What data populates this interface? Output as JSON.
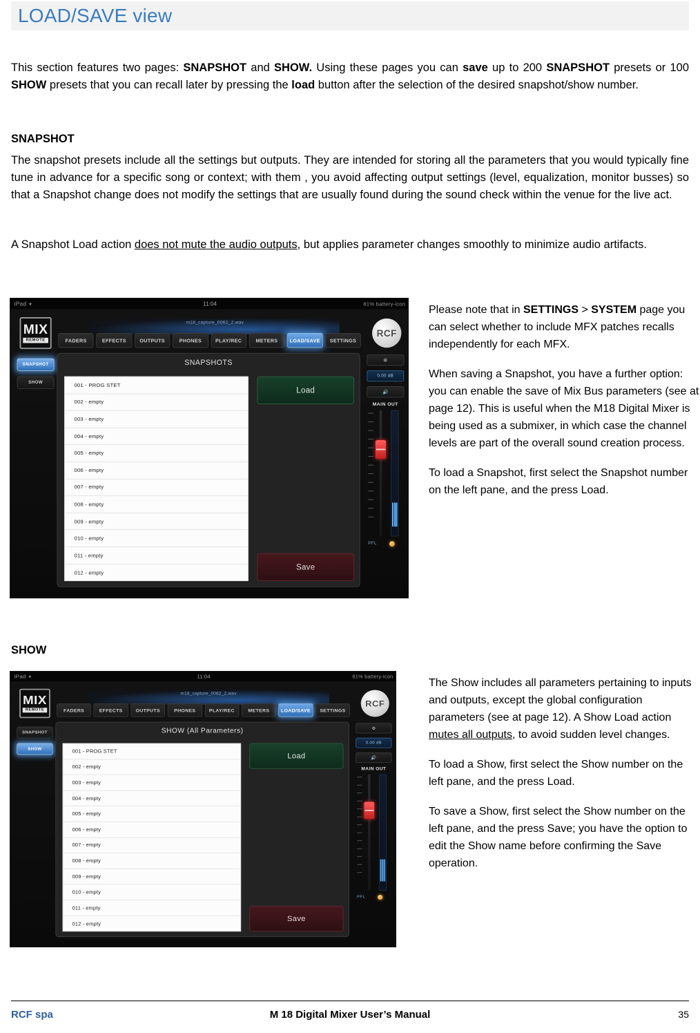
{
  "header": {
    "title": "LOAD/SAVE view"
  },
  "intro": {
    "line": "This section features two pages: SNAPSHOT and SHOW. Using these pages you can save up to 200 SNAPSHOT presets or 100 SHOW presets that you can recall later by pressing the load button after the selection of the desired snapshot/show number.",
    "t1": "This  section  features  two  pages:  ",
    "b1": "SNAPSHOT",
    "t2": "  and  ",
    "b2": "SHOW.",
    "t3": "  Using  these  pages  you  can  ",
    "b3": "save",
    "t4": "  up  to  200  ",
    "b4": "SNAPSHOT",
    "t5": "  presets  or  100  ",
    "b5": "SHOW",
    "t6": "  presets  that  you  can  recall  later  by  pressing  the  ",
    "b6": "load",
    "t7": "  button  after  the selection of the desired snapshot/show number."
  },
  "snapshot_section": {
    "heading": "SNAPSHOT",
    "para1": "The snapshot presets include all the settings but outputs. They are intended for storing all the parameters that you would typically fine tune in advance for a specific song or context; with them , you avoid affecting output settings (level, equalization, monitor busses) so that a Snapshot change does not modify the settings that are usually found during the sound check within the venue for the live act.",
    "para2_a": "A  Snapshot   Load  action  ",
    "para2_u": "does  not  mute  the  audio  outputs",
    "para2_b": ",  but  applies  parameter  changes  smoothly  to minimize audio artifacts."
  },
  "show_section": {
    "heading": "SHOW"
  },
  "note_snapshot": {
    "p1_a": "Please note that in ",
    "p1_b1": "SETTINGS",
    "p1_mid": " > ",
    "p1_b2": "SYSTEM",
    "p1_c": " page you can select whether to include MFX patches recalls independently for each MFX.",
    "p2": "When saving a Snapshot, you have a further option: you can enable the save of Mix Bus parameters (see at page 12). This is useful when the M18 Digital Mixer is being used as a submixer, in which case the channel levels are part of the overall sound creation process.",
    "p3": "To load a Snapshot, first select the Snapshot number on the left pane, and the press Load."
  },
  "note_show": {
    "p1_a": "The Show includes all parameters pertaining to inputs and outputs, except the global configuration parameters (see at page 12).  A Show Load action ",
    "p1_u": "mutes all outputs",
    "p1_b": ", to avoid sudden level changes.",
    "p2": "To load a Show, first select the Show number on the left pane, and the press Load.",
    "p3": "To save a Show, first select the Show number on the left pane, and the press Save; you have the option to edit the Show name before confirming the Save operation."
  },
  "screenshot_snapshot": {
    "status_bar": {
      "carrier": "iPad",
      "wifi_icon": "wifi-icon",
      "clock": "11:04",
      "battery": "81% battery-icon"
    },
    "logo": {
      "line1": "MIX",
      "line2": "REMOTE"
    },
    "filename": "m18_capture_0062_2.wav",
    "tabs": [
      {
        "label": "FADERS",
        "active": false
      },
      {
        "label": "EFFECTS",
        "active": false
      },
      {
        "label": "OUTPUTS",
        "active": false
      },
      {
        "label": "PHONES",
        "active": false
      },
      {
        "label": "PLAY/REC",
        "active": false
      },
      {
        "label": "METERS",
        "active": false
      },
      {
        "label": "LOAD/SAVE",
        "active": true
      },
      {
        "label": "SETTINGS",
        "active": false
      }
    ],
    "brand": "RCF",
    "rail": [
      {
        "label": "SNAPSHOT",
        "active": true
      },
      {
        "label": "SHOW",
        "active": false
      }
    ],
    "panel_title": "SNAPSHOTS",
    "presets": [
      "001 - PROG STET",
      "002 - empty",
      "003 - empty",
      "004 - empty",
      "005 - empty",
      "006 - empty",
      "007 - empty",
      "008 - empty",
      "009 - empty",
      "010 - empty",
      "011 - empty",
      "012 - empty"
    ],
    "load_label": "Load",
    "save_label": "Save",
    "gear_icon": "gear-icon",
    "db_value": "0.00 dB",
    "speaker_icon": "speaker-icon",
    "main_out_label": "MAIN OUT",
    "pfl_label": "PFL"
  },
  "screenshot_show": {
    "status_bar": {
      "carrier": "iPad",
      "wifi_icon": "wifi-icon",
      "clock": "11:04",
      "battery": "81% battery-icon"
    },
    "logo": {
      "line1": "MIX",
      "line2": "REMOTE"
    },
    "filename": "m18_capture_0062_2.wav",
    "tabs": [
      {
        "label": "FADERS",
        "active": false
      },
      {
        "label": "EFFECTS",
        "active": false
      },
      {
        "label": "OUTPUTS",
        "active": false
      },
      {
        "label": "PHONES",
        "active": false
      },
      {
        "label": "PLAY/REC",
        "active": false
      },
      {
        "label": "METERS",
        "active": false
      },
      {
        "label": "LOAD/SAVE",
        "active": true
      },
      {
        "label": "SETTINGS",
        "active": false
      }
    ],
    "brand": "RCF",
    "rail": [
      {
        "label": "SNAPSHOT",
        "active": false
      },
      {
        "label": "SHOW",
        "active": true
      }
    ],
    "panel_title": "SHOW (All Parameters)",
    "presets": [
      "001 - PROG STET",
      "002 - empty",
      "003 - empty",
      "004 - empty",
      "005 - empty",
      "006 - empty",
      "007 - empty",
      "008 - empty",
      "009 - empty",
      "010 - empty",
      "011 - empty",
      "012 - empty"
    ],
    "load_label": "Load",
    "save_label": "Save",
    "gear_icon": "gear-icon",
    "db_value": "0.00 dB",
    "speaker_icon": "speaker-icon",
    "main_out_label": "MAIN OUT",
    "pfl_label": "PFL"
  },
  "footer": {
    "left": "RCF spa",
    "center": "M 18 Digital Mixer User’s Manual",
    "page": "35"
  }
}
